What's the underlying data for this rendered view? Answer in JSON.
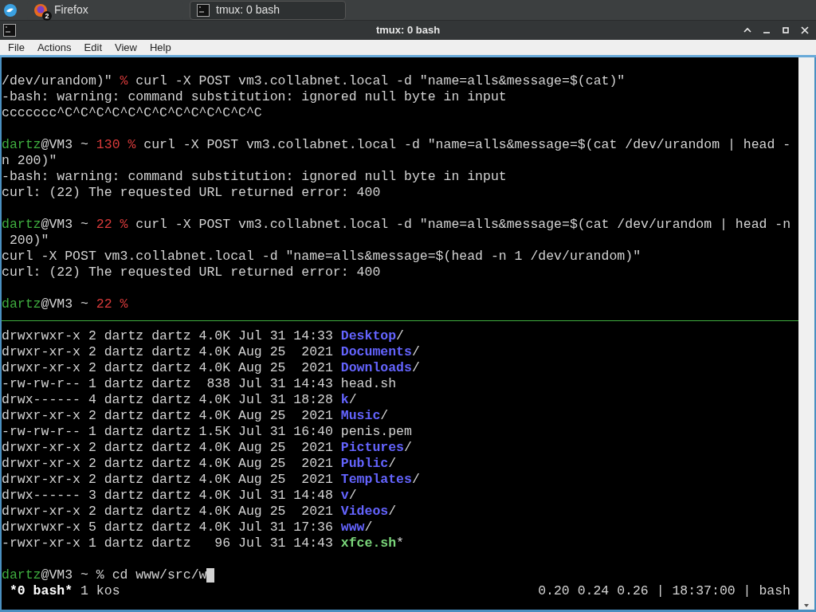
{
  "taskbar": {
    "tasks": [
      {
        "label": "Firefox",
        "badge": "2",
        "kind": "browser",
        "selected": false
      },
      {
        "label": "tmux: 0 bash",
        "kind": "terminal",
        "selected": true
      }
    ]
  },
  "window": {
    "title": "tmux: 0 bash"
  },
  "menu": [
    "File",
    "Actions",
    "Edit",
    "View",
    "Help"
  ],
  "panes": [
    {
      "lines": [
        {
          "kind": "output",
          "segs": [
            {
              "text": "/dev/urandom)\" ",
              "kind": "text"
            },
            {
              "text": "%",
              "kind": "status"
            },
            {
              "text": " curl -X POST vm3.collabnet.local -d \"name=alls&message=$(cat)\"",
              "kind": "text"
            }
          ]
        },
        {
          "kind": "output",
          "segs": [
            {
              "text": "-bash: warning: command substitution: ignored null byte in input",
              "kind": "text"
            }
          ]
        },
        {
          "kind": "output",
          "segs": [
            {
              "text": "ccccccc^C^C^C^C^C^C^C^C^C^C^C^C^C",
              "kind": "text"
            }
          ]
        },
        {
          "kind": "blank"
        },
        {
          "kind": "output",
          "segs": [
            {
              "text": "dartz",
              "kind": "user"
            },
            {
              "text": "@VM3 ~ ",
              "kind": "text"
            },
            {
              "text": "130 %",
              "kind": "status"
            },
            {
              "text": " curl -X POST vm3.collabnet.local -d \"name=alls&message=$(cat /dev/urandom | head -",
              "kind": "text"
            }
          ]
        },
        {
          "kind": "output",
          "segs": [
            {
              "text": "n 200)\"",
              "kind": "text"
            }
          ]
        },
        {
          "kind": "output",
          "segs": [
            {
              "text": "-bash: warning: command substitution: ignored null byte in input",
              "kind": "text"
            }
          ]
        },
        {
          "kind": "output",
          "segs": [
            {
              "text": "curl: (22) The requested URL returned error: 400",
              "kind": "text"
            }
          ]
        },
        {
          "kind": "blank"
        },
        {
          "kind": "output",
          "segs": [
            {
              "text": "dartz",
              "kind": "user"
            },
            {
              "text": "@VM3 ~ ",
              "kind": "text"
            },
            {
              "text": "22 %",
              "kind": "status"
            },
            {
              "text": " curl -X POST vm3.collabnet.local -d \"name=alls&message=$(cat /dev/urandom | head -n",
              "kind": "text"
            }
          ]
        },
        {
          "kind": "output",
          "segs": [
            {
              "text": " 200)\"",
              "kind": "text"
            }
          ]
        },
        {
          "kind": "output",
          "segs": [
            {
              "text": "curl -X POST vm3.collabnet.local -d \"name=alls&message=$(head -n 1 /dev/urandom)\"",
              "kind": "text"
            }
          ]
        },
        {
          "kind": "output",
          "segs": [
            {
              "text": "curl: (22) The requested URL returned error: 400",
              "kind": "text"
            }
          ]
        },
        {
          "kind": "blank"
        },
        {
          "kind": "output",
          "segs": [
            {
              "text": "dartz",
              "kind": "user"
            },
            {
              "text": "@VM3 ~ ",
              "kind": "text"
            },
            {
              "text": "22 %",
              "kind": "status"
            }
          ]
        }
      ]
    },
    {
      "lines": [
        {
          "kind": "output",
          "segs": [
            {
              "text": "drwxrwxr-x 2 dartz dartz 4.0K Jul 31 14:33 ",
              "kind": "text"
            },
            {
              "text": "Desktop",
              "kind": "dir"
            },
            {
              "text": "/",
              "kind": "text"
            }
          ]
        },
        {
          "kind": "output",
          "segs": [
            {
              "text": "drwxr-xr-x 2 dartz dartz 4.0K Aug 25  2021 ",
              "kind": "text"
            },
            {
              "text": "Documents",
              "kind": "dir"
            },
            {
              "text": "/",
              "kind": "text"
            }
          ]
        },
        {
          "kind": "output",
          "segs": [
            {
              "text": "drwxr-xr-x 2 dartz dartz 4.0K Aug 25  2021 ",
              "kind": "text"
            },
            {
              "text": "Downloads",
              "kind": "dir"
            },
            {
              "text": "/",
              "kind": "text"
            }
          ]
        },
        {
          "kind": "output",
          "segs": [
            {
              "text": "-rw-rw-r-- 1 dartz dartz  838 Jul 31 14:43 head.sh",
              "kind": "text"
            }
          ]
        },
        {
          "kind": "output",
          "segs": [
            {
              "text": "drwx------ 4 dartz dartz 4.0K Jul 31 18:28 ",
              "kind": "text"
            },
            {
              "text": "k",
              "kind": "dir"
            },
            {
              "text": "/",
              "kind": "text"
            }
          ]
        },
        {
          "kind": "output",
          "segs": [
            {
              "text": "drwxr-xr-x 2 dartz dartz 4.0K Aug 25  2021 ",
              "kind": "text"
            },
            {
              "text": "Music",
              "kind": "dir"
            },
            {
              "text": "/",
              "kind": "text"
            }
          ]
        },
        {
          "kind": "output",
          "segs": [
            {
              "text": "-rw-rw-r-- 1 dartz dartz 1.5K Jul 31 16:40 penis.pem",
              "kind": "text"
            }
          ]
        },
        {
          "kind": "output",
          "segs": [
            {
              "text": "drwxr-xr-x 2 dartz dartz 4.0K Aug 25  2021 ",
              "kind": "text"
            },
            {
              "text": "Pictures",
              "kind": "dir"
            },
            {
              "text": "/",
              "kind": "text"
            }
          ]
        },
        {
          "kind": "output",
          "segs": [
            {
              "text": "drwxr-xr-x 2 dartz dartz 4.0K Aug 25  2021 ",
              "kind": "text"
            },
            {
              "text": "Public",
              "kind": "dir"
            },
            {
              "text": "/",
              "kind": "text"
            }
          ]
        },
        {
          "kind": "output",
          "segs": [
            {
              "text": "drwxr-xr-x 2 dartz dartz 4.0K Aug 25  2021 ",
              "kind": "text"
            },
            {
              "text": "Templates",
              "kind": "dir"
            },
            {
              "text": "/",
              "kind": "text"
            }
          ]
        },
        {
          "kind": "output",
          "segs": [
            {
              "text": "drwx------ 3 dartz dartz 4.0K Jul 31 14:48 ",
              "kind": "text"
            },
            {
              "text": "v",
              "kind": "dir"
            },
            {
              "text": "/",
              "kind": "text"
            }
          ]
        },
        {
          "kind": "output",
          "segs": [
            {
              "text": "drwxr-xr-x 2 dartz dartz 4.0K Aug 25  2021 ",
              "kind": "text"
            },
            {
              "text": "Videos",
              "kind": "dir"
            },
            {
              "text": "/",
              "kind": "text"
            }
          ]
        },
        {
          "kind": "output",
          "segs": [
            {
              "text": "drwxrwxr-x 5 dartz dartz 4.0K Jul 31 17:36 ",
              "kind": "text"
            },
            {
              "text": "www",
              "kind": "dir"
            },
            {
              "text": "/",
              "kind": "text"
            }
          ]
        },
        {
          "kind": "output",
          "segs": [
            {
              "text": "-rwxr-xr-x 1 dartz dartz   96 Jul 31 14:43 ",
              "kind": "text"
            },
            {
              "text": "xfce.sh",
              "kind": "exec"
            },
            {
              "text": "*",
              "kind": "text"
            }
          ]
        },
        {
          "kind": "blank"
        },
        {
          "kind": "output",
          "segs": [
            {
              "text": "dartz",
              "kind": "user"
            },
            {
              "text": "@VM3 ~ % cd www/src/w",
              "kind": "text"
            }
          ]
        }
      ],
      "cursor": true
    }
  ],
  "status_bar": {
    "window": "*0 bash*",
    "other": "1 kos",
    "right": "0.20 0.24 0.26 | 18:37:00 | bash"
  }
}
